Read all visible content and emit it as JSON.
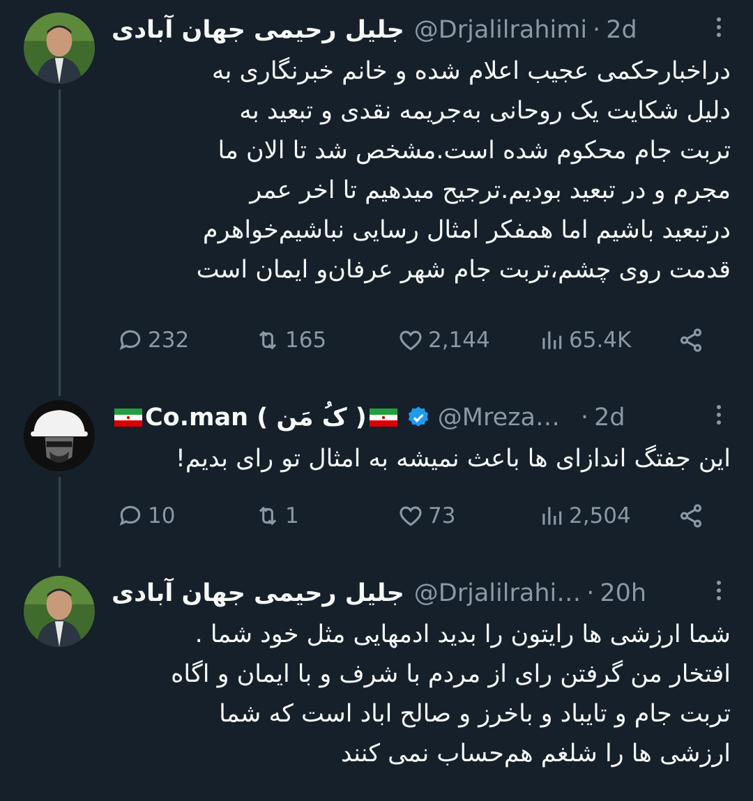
{
  "tweets": [
    {
      "name": "جلیل رحیمی جهان آبادی",
      "handle": "@Drjalilrahimi",
      "time": "2d",
      "lines": [
        "دراخبارحکمی عجیب اعلام شده و خانم خبرنگاری به",
        "دلیل شکایت یک روحانی به‌جریمه نقدی و تبعید به",
        "تربت جام محکوم شده است.مشخص شد تا الان ما",
        "مجرم و در تبعید بودیم.ترجیح میدهیم تا اخر عمر",
        "درتبعید باشیم اما همفکر  امثال رسایی نباشیم‌خواهرم",
        "قدمت روی چشم،تربت جام شهر عرفان‌و ایمان است"
      ],
      "replies": "232",
      "retweets": "165",
      "likes": "2,144",
      "views": "65.4K"
    },
    {
      "name": "Co.man ( کُ مَن )",
      "handle": "@Mreza…",
      "time": "2d",
      "verified": true,
      "lines": [
        "این جفتگ اندازای ها باعث نمیشه به امثال تو رای بدیم!"
      ],
      "replies": "10",
      "retweets": "1",
      "likes": "73",
      "views": "2,504"
    },
    {
      "name": "جلیل رحیمی جهان آبادی",
      "handle": "@Drjalilrahi…",
      "time": "20h",
      "lines": [
        "شما ارزشی ها رایتون را بدید ادمهایی مثل خود شما .",
        "افتخار من گرفتن رای از مردم با شرف و با ایمان و اگاه",
        "تربت جام و تایباد و باخرز و صالح اباد است که شما",
        "ارزشی ها را شلغم هم‌حساب نمی کنند"
      ]
    }
  ],
  "colors": {
    "background": "#15202b",
    "text": "#f7f9f9",
    "muted": "#8b98a5",
    "verified": "#1d9bf0"
  }
}
